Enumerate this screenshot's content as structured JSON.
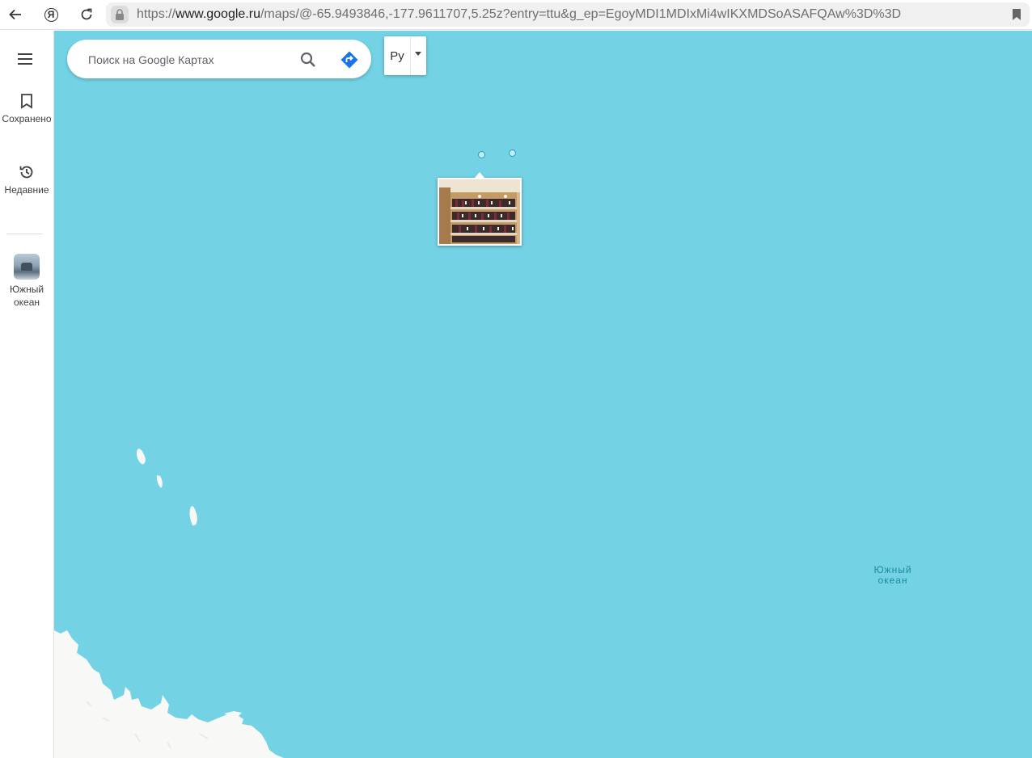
{
  "browser": {
    "url_prefix": "https://",
    "url_host": "www.google.ru",
    "url_path": "/maps/@-65.9493846,-177.9611707,5.25z?entry=ttu&g_ep=EgoyMDI1MDIxMi4wIKXMDSoASAFQAw%3D%3D",
    "icons": [
      "back-arrow-icon",
      "yandex-icon",
      "reload-icon",
      "lock-icon",
      "bookmark-icon"
    ],
    "yandex_glyph": "Я"
  },
  "rail": {
    "items": [
      {
        "label": "Сохранено",
        "icon": "bookmark-icon"
      },
      {
        "label": "Недавние",
        "icon": "history-icon"
      },
      {
        "label": "Южный океан",
        "icon": "place-thumbnail"
      }
    ]
  },
  "search": {
    "placeholder": "Поиск на Google Картах"
  },
  "layer_switch": {
    "label": "Ру"
  },
  "map": {
    "water_color": "#73d3e5",
    "land_color": "#f8f8f6",
    "label_line1": "Южный",
    "label_line2": "океан"
  },
  "colors": {
    "directions_blue": "#1a73e8",
    "label_teal": "#1b8aa0"
  }
}
